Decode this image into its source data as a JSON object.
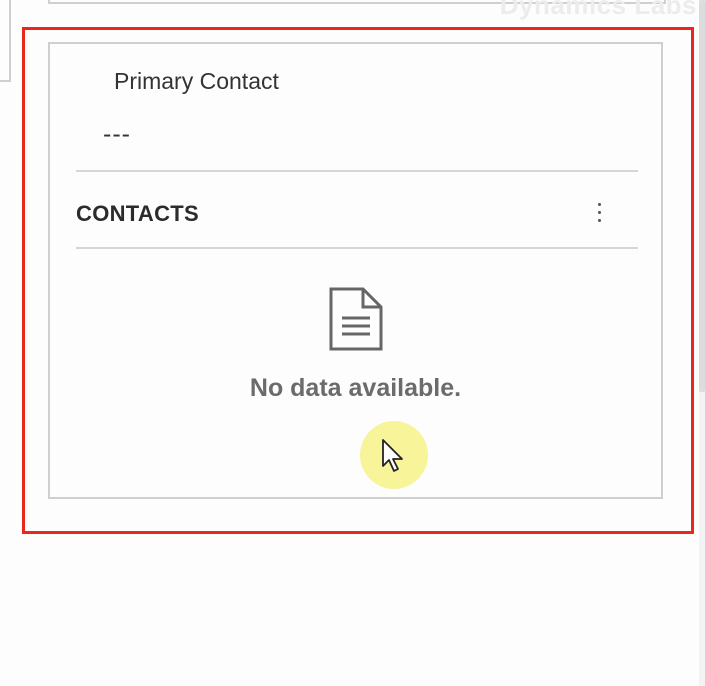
{
  "watermark": {
    "text": "Dynamics Labs"
  },
  "primary_contact": {
    "label": "Primary Contact",
    "value": "---"
  },
  "contacts_section": {
    "title": "CONTACTS",
    "more_icon": "more-vertical-icon",
    "empty_icon": "document-icon",
    "empty_message": "No data available."
  },
  "colors": {
    "highlight_border": "#e8281c",
    "card_border": "#cfcfcf",
    "cursor_halo": "#f6f078"
  }
}
